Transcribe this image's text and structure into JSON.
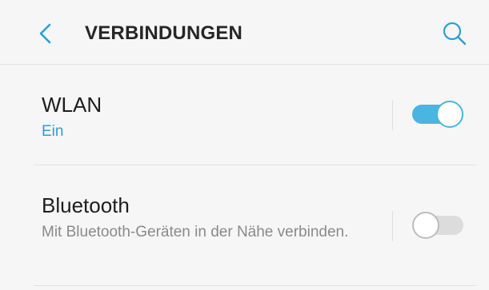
{
  "header": {
    "title": "VERBINDUNGEN",
    "back_icon": "chevron-left-icon",
    "search_icon": "search-icon"
  },
  "settings": [
    {
      "title": "WLAN",
      "subtitle": "Ein",
      "enabled": true
    },
    {
      "title": "Bluetooth",
      "subtitle": "Mit Bluetooth-Geräten in der Nähe verbinden.",
      "enabled": false
    }
  ],
  "colors": {
    "accent": "#4bb5e2",
    "subtitle_on": "#2b9fd6",
    "background": "#f6f6f6"
  }
}
